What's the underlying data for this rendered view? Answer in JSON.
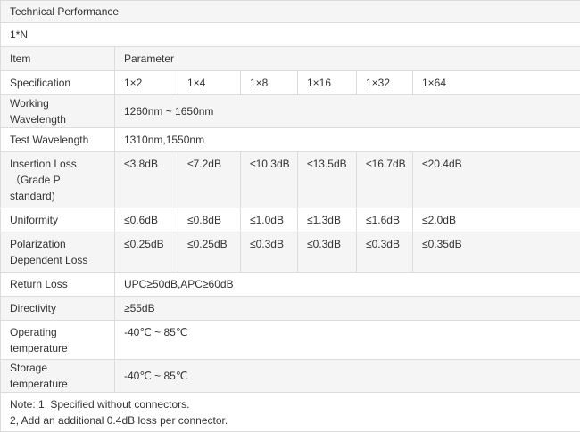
{
  "table": {
    "title": "Technical Performance",
    "subtitle": "1*N",
    "header": {
      "label": "Item",
      "value": "Parameter"
    },
    "specification": {
      "label": "Specification",
      "values": [
        "1×2",
        "1×4",
        "1×8",
        "1×16",
        "1×32",
        "1×64"
      ]
    },
    "working_wavelength": {
      "label": "Working Wavelength",
      "value": "1260nm ~ 1650nm"
    },
    "test_wavelength": {
      "label": "Test Wavelength",
      "value": "1310nm,1550nm"
    },
    "insertion_loss": {
      "label_lines": [
        "Insertion Loss",
        "（Grade P",
        "standard)"
      ],
      "values": [
        "≤3.8dB",
        "≤7.2dB",
        "≤10.3dB",
        "≤13.5dB",
        "≤16.7dB",
        "≤20.4dB"
      ]
    },
    "uniformity": {
      "label": "Uniformity",
      "values": [
        "≤0.6dB",
        "≤0.8dB",
        "≤1.0dB",
        "≤1.3dB",
        "≤1.6dB",
        "≤2.0dB"
      ]
    },
    "polarization_dependent_loss": {
      "label_lines": [
        "Polarization",
        "Dependent Loss"
      ],
      "values": [
        "≤0.25dB",
        "≤0.25dB",
        "≤0.3dB",
        "≤0.3dB",
        "≤0.3dB",
        "≤0.35dB"
      ]
    },
    "return_loss": {
      "label": "Return Loss",
      "value": "UPC≥50dB,APC≥60dB"
    },
    "directivity": {
      "label": "Directivity",
      "value": "≥55dB"
    },
    "operating_temperature": {
      "label_lines": [
        "Operating",
        "temperature"
      ],
      "value": "-40℃ ~ 85℃"
    },
    "storage_temperature": {
      "label": "Storage temperature",
      "value": "-40℃ ~ 85℃"
    },
    "notes": [
      "Note: 1, Specified without connectors.",
      "2, Add an additional 0.4dB loss per connector."
    ]
  }
}
